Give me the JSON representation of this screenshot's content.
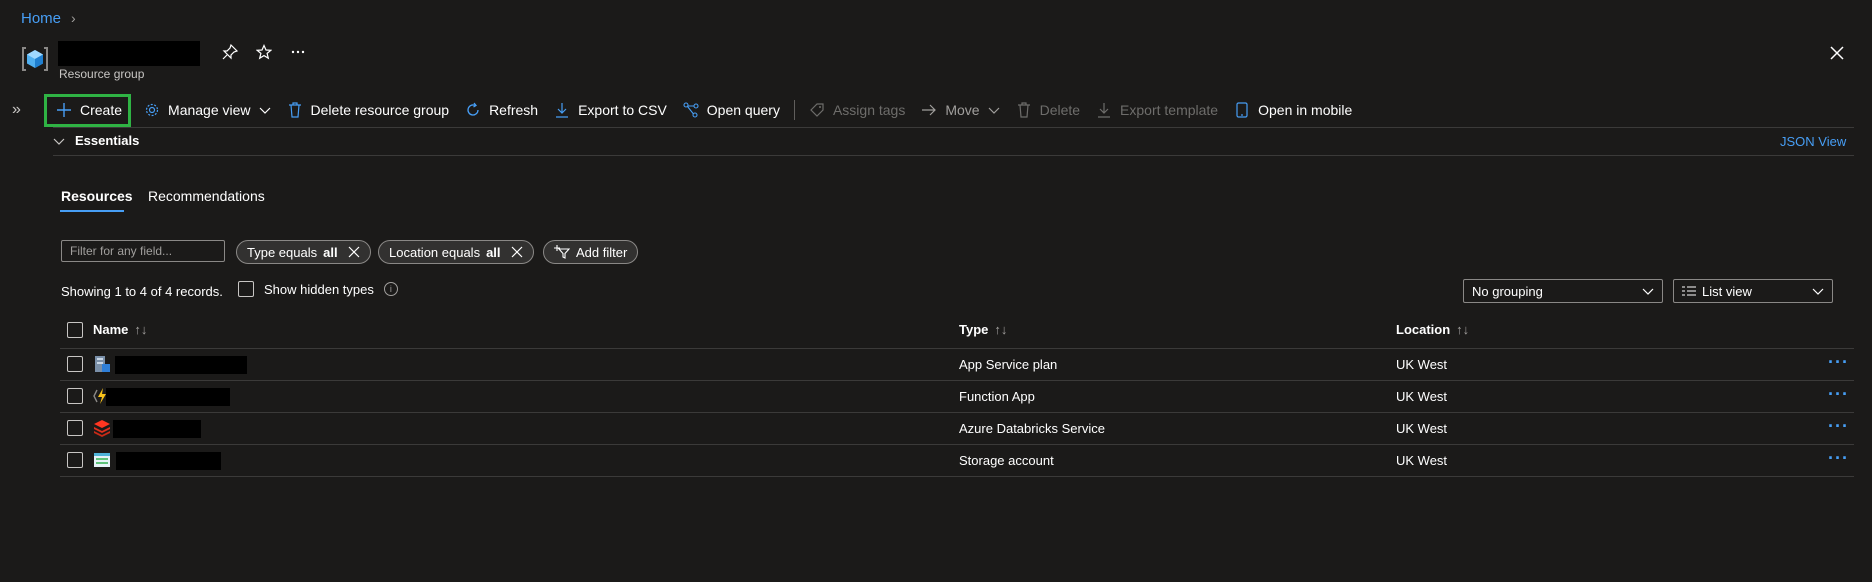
{
  "breadcrumb": {
    "home": "Home"
  },
  "header": {
    "subtitle": "Resource group"
  },
  "toolbar": {
    "create": "Create",
    "manage_view": "Manage view",
    "delete_rg": "Delete resource group",
    "refresh": "Refresh",
    "export_csv": "Export to CSV",
    "open_query": "Open query",
    "assign_tags": "Assign tags",
    "move": "Move",
    "delete": "Delete",
    "export_template": "Export template",
    "open_mobile": "Open in mobile"
  },
  "essentials": {
    "label": "Essentials",
    "json_view": "JSON View"
  },
  "tabs": {
    "resources": "Resources",
    "recommendations": "Recommendations"
  },
  "filters": {
    "placeholder": "Filter for any field...",
    "type_prefix": "Type equals",
    "type_value": "all",
    "location_prefix": "Location equals",
    "location_value": "all",
    "add_filter": "Add filter"
  },
  "list": {
    "records": "Showing 1 to 4 of 4 records.",
    "show_hidden": "Show hidden types",
    "grouping": "No grouping",
    "view": "List view"
  },
  "table": {
    "headers": {
      "name": "Name",
      "type": "Type",
      "location": "Location"
    },
    "rows": [
      {
        "type": "App Service plan",
        "location": "UK West",
        "icon": "app-service-plan-icon"
      },
      {
        "type": "Function App",
        "location": "UK West",
        "icon": "function-app-icon"
      },
      {
        "type": "Azure Databricks Service",
        "location": "UK West",
        "icon": "databricks-icon"
      },
      {
        "type": "Storage account",
        "location": "UK West",
        "icon": "storage-account-icon"
      }
    ]
  },
  "colors": {
    "accent": "#479ef5",
    "highlight": "#2fb344",
    "background": "#1b1a19"
  }
}
